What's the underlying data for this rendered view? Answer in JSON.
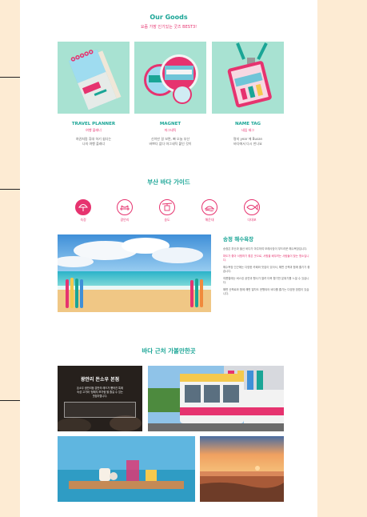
{
  "goods": {
    "title": "Our Goods",
    "subtitle": "요즘 가장 인기있는 굿즈 BEST3!",
    "items": [
      {
        "name": "TRAVEL PLANNER",
        "kr": "여행 플래너",
        "desc1": "여권처럼 휴대 하기 쉽다는",
        "desc2": "나의 여행 플래너",
        "icon": "planner-image"
      },
      {
        "name": "MAGNET",
        "kr": "마그네틱",
        "desc1": "신이만 걸 보면, 빠 오늘 부산",
        "desc2": "바쁘다 없다 마그네틱 붙인 것이",
        "icon": "magnet-image"
      },
      {
        "name": "NAME TAG",
        "kr": "네임 태그",
        "desc1": "명지 year 에 Busan",
        "desc2": "바다에서 다시 만나요",
        "icon": "name-tag-image"
      }
    ]
  },
  "guide": {
    "title": "부산 바다 가이드",
    "icons": [
      {
        "label": "숙정",
        "icon": "beach-umbrella-icon"
      },
      {
        "label": "광안리",
        "icon": "bridge-icon"
      },
      {
        "label": "송도",
        "icon": "cable-car-icon"
      },
      {
        "label": "해운대",
        "icon": "sun-icon"
      },
      {
        "label": "다대포",
        "icon": "fish-icon"
      }
    ],
    "featured": {
      "title": "송정 해수욕장",
      "paragraphs": [
        "송정은 부산과 울산 바다가 마주하여 모래사장이 부드러운 해수욕장입니다.",
        "파도가 좋아 서핑하기 좋은 곳으로, 서핑을 배우려는 사람들이 찾는 명소입니다.",
        "해수욕장 인근에는 다양한 카페와 맛집이 있어서, 해변 산책과 함께 즐기기 좋습니다.",
        "여름철에는 버스킹 공연과 행사가 열려 더욱 활기찬 분위기를 느낄 수 있습니다.",
        "해변 산책로와 함께 해변 열차도 운행되어 바다를 즐기는 다양한 방법이 있습니다."
      ]
    }
  },
  "nearby": {
    "title": "바다 근처 가볼만한곳",
    "restaurant": {
      "name": "광안리 돈소우 본점",
      "desc1": "돈소우 광안리점 분만의 레드가 뿜어진 특제",
      "desc2": "숙성 고기와 '정돼지 쪼가림'을 즐길 수 있는",
      "desc3": "맛집이랍니다."
    }
  }
}
